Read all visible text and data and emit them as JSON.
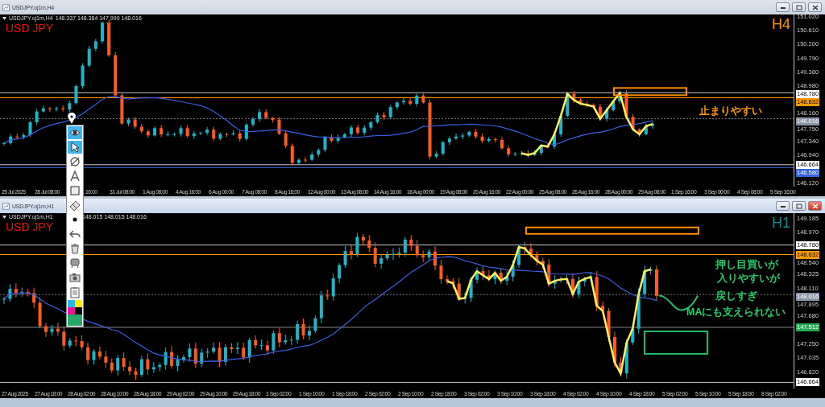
{
  "windows": [
    {
      "title": "USDJPY.oj1m,H4",
      "active": false,
      "info": {
        "symbol": "USDJPY.oj1m,H4",
        "prices": "148.337 148.384 147.999 148.016"
      },
      "symbol": "USD JPY",
      "timeframe": "H4",
      "price_labels": [
        {
          "text": "151.020",
          "kind": "tick"
        },
        {
          "text": "150.610",
          "kind": "tick"
        },
        {
          "text": "150.200",
          "kind": "tick"
        },
        {
          "text": "149.790",
          "kind": "tick"
        },
        {
          "text": "149.380",
          "kind": "tick"
        },
        {
          "text": "148.980",
          "kind": "tick"
        },
        {
          "text": "148.780",
          "kind": "marker",
          "color": "#ffffff"
        },
        {
          "text": "148.632",
          "kind": "marker",
          "color": "#ff9900"
        },
        {
          "text": "148.160",
          "kind": "tick"
        },
        {
          "text": "148.016",
          "kind": "marker",
          "color": "#8a96a8"
        },
        {
          "text": "147.750",
          "kind": "tick"
        },
        {
          "text": "147.340",
          "kind": "tick"
        },
        {
          "text": "146.940",
          "kind": "tick"
        },
        {
          "text": "146.664",
          "kind": "marker",
          "color": "#ffffff"
        },
        {
          "text": "146.580",
          "kind": "marker",
          "color": "#3366dd"
        },
        {
          "text": "146.120",
          "kind": "tick"
        }
      ],
      "time_labels": [
        "25 Jul 2025",
        "28 Jul 08:00",
        "16:00",
        "31 Jul 08:00",
        "1 Aug 08:00",
        "4 Aug 16:00",
        "6 Aug 00:00",
        "7 Aug 08:00",
        "8 Aug 16:00",
        "12 Aug 00:00",
        "13 Aug 08:00",
        "14 Aug 16:00",
        "18 Aug 00:00",
        "19 Aug 08:00",
        "20 Aug 16:00",
        "22 Aug 00:00",
        "25 Aug 08:00",
        "26 Aug 16:00",
        "28 Aug 00:00",
        "29 Aug 08:00",
        "1 Sep 16:00",
        "3 Sep 00:00",
        "4 Sep 08:00",
        "5 Sep 16:00"
      ],
      "notes": [
        {
          "text": "止まりやすい",
          "color": "#ff9900"
        }
      ]
    },
    {
      "title": "USDJPY.oj1m,H1",
      "active": true,
      "info": {
        "symbol": "USDJPY.oj1m,H1",
        "prices": "148.015 148.015 148.016"
      },
      "symbol": "USD JPY",
      "timeframe": "H1",
      "price_labels": [
        {
          "text": "149.185",
          "kind": "tick"
        },
        {
          "text": "148.970",
          "kind": "tick"
        },
        {
          "text": "148.780",
          "kind": "marker",
          "color": "#ffffff"
        },
        {
          "text": "148.632",
          "kind": "marker",
          "color": "#ff9900"
        },
        {
          "text": "148.540",
          "kind": "tick"
        },
        {
          "text": "148.325",
          "kind": "tick"
        },
        {
          "text": "148.110",
          "kind": "tick"
        },
        {
          "text": "148.016",
          "kind": "marker",
          "color": "#8a96a8"
        },
        {
          "text": "147.895",
          "kind": "tick"
        },
        {
          "text": "147.680",
          "kind": "tick"
        },
        {
          "text": "147.512",
          "kind": "marker",
          "color": "#22aa55"
        },
        {
          "text": "147.250",
          "kind": "tick"
        },
        {
          "text": "147.035",
          "kind": "tick"
        },
        {
          "text": "146.820",
          "kind": "tick"
        },
        {
          "text": "146.664",
          "kind": "marker",
          "color": "#ffffff"
        }
      ],
      "time_labels": [
        "27 Aug 2025",
        "27 Aug 18:00",
        "28 Aug 02:00",
        "28 Aug 10:00",
        "28 Aug 18:00",
        "29 Aug 02:00",
        "29 Aug 10:00",
        "29 Aug 18:00",
        "1 Sep 02:00",
        "1 Sep 10:00",
        "1 Sep 18:00",
        "2 Sep 02:00",
        "2 Sep 10:00",
        "2 Sep 18:00",
        "3 Sep 02:00",
        "3 Sep 10:00",
        "3 Sep 18:00",
        "4 Sep 02:00",
        "4 Sep 10:00",
        "4 Sep 18:00",
        "5 Sep 02:00",
        "5 Sep 10:00",
        "5 Sep 18:00",
        "8 Sep 02:00"
      ],
      "notes": [
        {
          "text": "押し目買いが",
          "color": "#22cc66"
        },
        {
          "text": "入りやすいが",
          "color": "#22cc66"
        },
        {
          "text": "戻しすぎ",
          "color": "#22cc66"
        },
        {
          "text": "MAにも支えられない",
          "color": "#22cc66"
        }
      ]
    }
  ],
  "toolbar": {
    "tools": [
      {
        "kind": "eye",
        "selected": true
      },
      {
        "kind": "pointer",
        "selected": true
      },
      {
        "kind": "crossed-circle",
        "selected": false
      },
      {
        "kind": "text",
        "selected": false
      },
      {
        "kind": "rectangle",
        "selected": false
      },
      {
        "kind": "eraser",
        "selected": false
      },
      {
        "kind": "dot",
        "selected": false
      },
      {
        "kind": "undo",
        "selected": false
      },
      {
        "kind": "trash",
        "selected": false
      },
      {
        "kind": "monitor",
        "selected": false
      },
      {
        "kind": "camera",
        "selected": false
      },
      {
        "kind": "clipboard",
        "selected": false
      }
    ],
    "swatches": [
      {
        "color": "#29b6e8"
      },
      {
        "color": "#ffee00"
      },
      {
        "color": "#ee1199"
      },
      {
        "color": "#000000"
      },
      {
        "color": "#22aa66"
      }
    ]
  }
}
